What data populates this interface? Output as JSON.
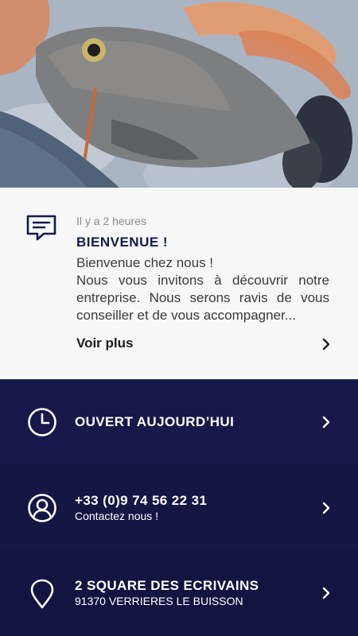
{
  "news": {
    "time": "Il y a 2 heures",
    "title": "BIENVENUE !",
    "line1": "Bienvenue chez nous !",
    "line2": "Nous vous invitons à découvrir notre entreprise. Nous serons ravis de vous conseiller et de vous accompagner...",
    "more_label": "Voir plus",
    "icon": "message-icon"
  },
  "hours": {
    "title": "OUVERT AUJOURD’HUI",
    "icon": "clock-icon"
  },
  "phone": {
    "title": "+33 (0)9 74 56 22 31",
    "subtitle": "Contactez nous !",
    "icon": "user-icon"
  },
  "address": {
    "title": "2 SQUARE DES ECRIVAINS",
    "subtitle": "91370 VERRIERES LE BUISSON",
    "icon": "map-pin-icon"
  },
  "colors": {
    "navy": "#17194a",
    "card_bg": "#f7f7f7"
  }
}
